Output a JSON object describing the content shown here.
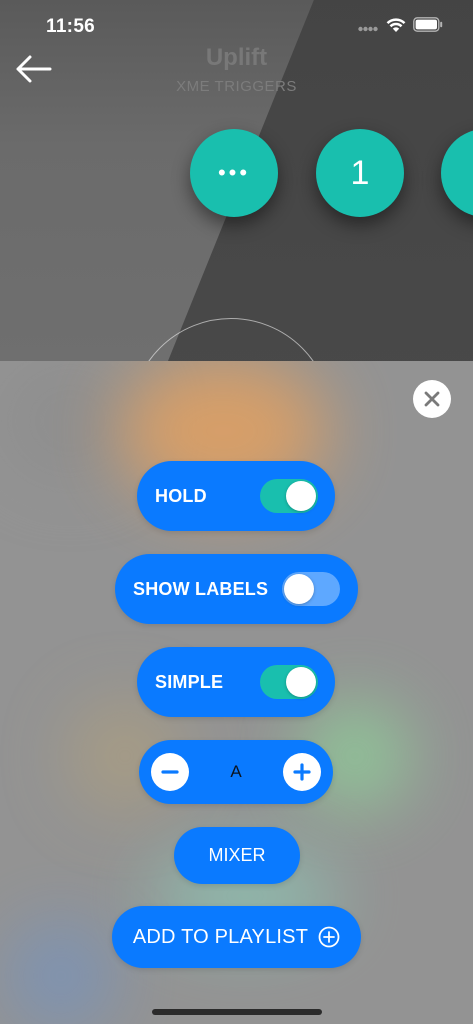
{
  "status_bar": {
    "time": "11:56"
  },
  "header": {
    "title": "Uplift",
    "subtitle": "XME TRIGGERS"
  },
  "triggers": [
    {
      "label": "•••"
    },
    {
      "label": "1"
    }
  ],
  "controls": {
    "hold": {
      "label": "HOLD",
      "on": true
    },
    "show_labels": {
      "label": "SHOW LABELS",
      "on": false
    },
    "simple": {
      "label": "SIMPLE",
      "on": true
    },
    "stepper": {
      "value": "A"
    },
    "mixer_label": "MIXER",
    "add_to_playlist_label": "ADD TO PLAYLIST"
  },
  "colors": {
    "accent_blue": "#0a7aff",
    "trigger_teal": "#19bfae",
    "toggle_off": "#5ea8ff"
  },
  "icons": {
    "back": "arrow-left-icon",
    "close": "close-icon",
    "minus": "minus-icon",
    "plus": "plus-icon",
    "add_circle": "plus-circle-icon",
    "signal": "cellular-signal-icon",
    "wifi": "wifi-icon",
    "battery": "battery-icon"
  }
}
